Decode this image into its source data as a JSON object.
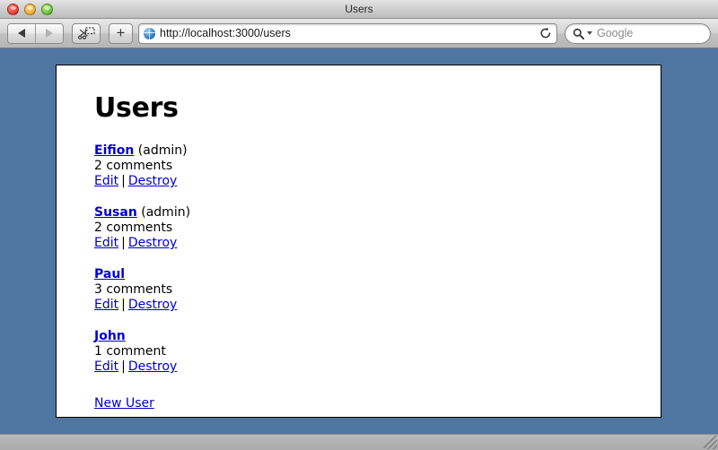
{
  "window": {
    "title": "Users",
    "controls": [
      {
        "name": "close-button",
        "color": "#e33b2e"
      },
      {
        "name": "minimize-button",
        "color": "#f0a92c"
      },
      {
        "name": "zoom-button",
        "color": "#63bf36"
      }
    ]
  },
  "toolbar": {
    "back_label": "",
    "forward_label": "",
    "snippet_label": "",
    "add_label": "+",
    "url": "http://localhost:3000/users",
    "reload_label": "",
    "search_placeholder": "Google"
  },
  "page": {
    "heading": "Users",
    "users": [
      {
        "name": "Eifion",
        "role": " (admin)",
        "comments": "2 comments",
        "edit_label": "Edit",
        "separator": "|",
        "destroy_label": "Destroy"
      },
      {
        "name": "Susan",
        "role": " (admin)",
        "comments": "2 comments",
        "edit_label": "Edit",
        "separator": "|",
        "destroy_label": "Destroy"
      },
      {
        "name": "Paul",
        "role": "",
        "comments": "3 comments",
        "edit_label": "Edit",
        "separator": "|",
        "destroy_label": "Destroy"
      },
      {
        "name": "John",
        "role": "",
        "comments": "1 comment",
        "edit_label": "Edit",
        "separator": "|",
        "destroy_label": "Destroy"
      }
    ],
    "new_user_label": "New User"
  },
  "statusbar": {
    "text": ""
  },
  "colors": {
    "desktop": "#4e76a0",
    "link": "#0000cc",
    "page_background": "#ffffff",
    "chrome": "#d4d4d4"
  }
}
